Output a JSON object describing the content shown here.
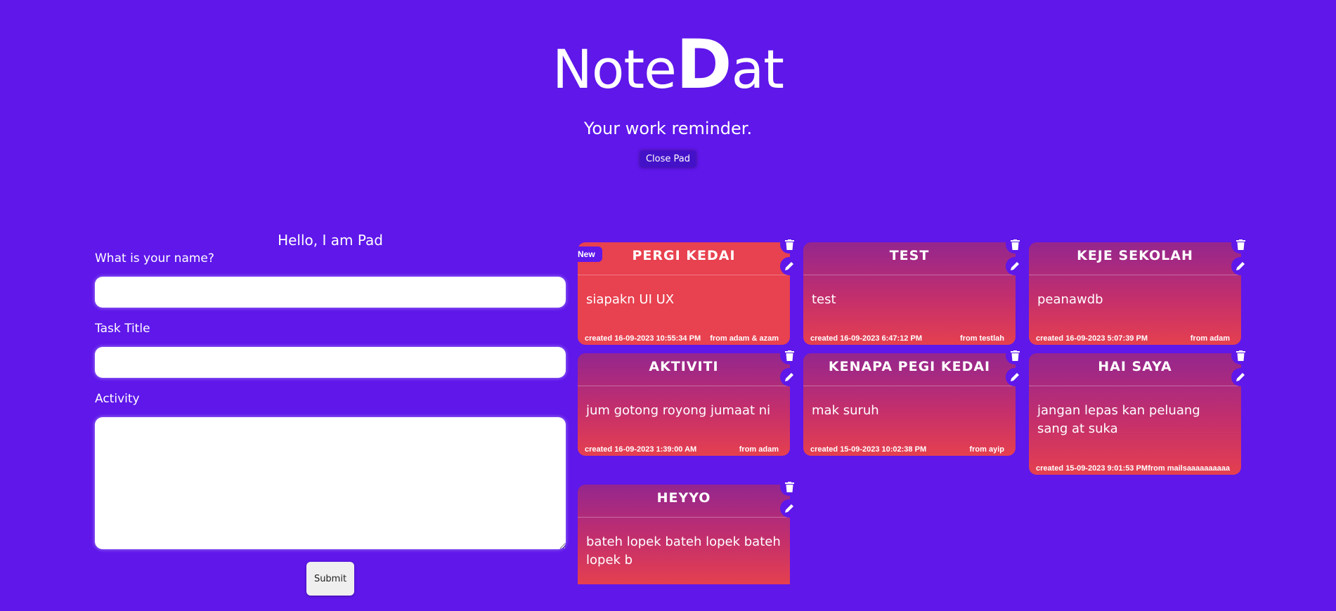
{
  "app": {
    "logo_prefix": "Note",
    "logo_big": "D",
    "logo_suffix": "at",
    "tagline": "Your work reminder.",
    "close_label": "Close Pad"
  },
  "form": {
    "title": "Hello, I am Pad",
    "name_label": "What is your name?",
    "task_label": "Task Title",
    "activity_label": "Activity",
    "name_value": "",
    "task_value": "",
    "activity_value": "",
    "submit_label": "Submit"
  },
  "notes": [
    {
      "title": "PERGI KEDAI",
      "body": "siapakn UI UX",
      "created": "created 16-09-2023 10:55:34 PM",
      "from": "from adam & azam",
      "badge": "New"
    },
    {
      "title": "TEST",
      "body": "test",
      "created": "created 16-09-2023 6:47:12 PM",
      "from": "from testlah"
    },
    {
      "title": "KEJE SEKOLAH",
      "body": "peanawdb",
      "created": "created 16-09-2023 5:07:39 PM",
      "from": "from adam"
    },
    {
      "title": "AKTIVITI",
      "body": "jum gotong royong jumaat ni",
      "created": "created 16-09-2023 1:39:00 AM",
      "from": "from adam"
    },
    {
      "title": "KENAPA PEGI KEDAI",
      "body": "mak suruh",
      "created": "created 15-09-2023 10:02:38 PM",
      "from": "from ayip"
    },
    {
      "title": "HAI SAYA",
      "body": "jangan lepas kan peluang sang at suka",
      "created": "created 15-09-2023 9:01:53 PM",
      "from": "from mailsaaaaaaaaaa"
    },
    {
      "title": "HEYYO",
      "body": "bateh lopek bateh lopek bateh lopek b"
    }
  ],
  "colors": {
    "background": "#5f17ea",
    "note_top": "#94268e",
    "note_bottom": "#e5404f",
    "note_red": "#e8414f"
  }
}
